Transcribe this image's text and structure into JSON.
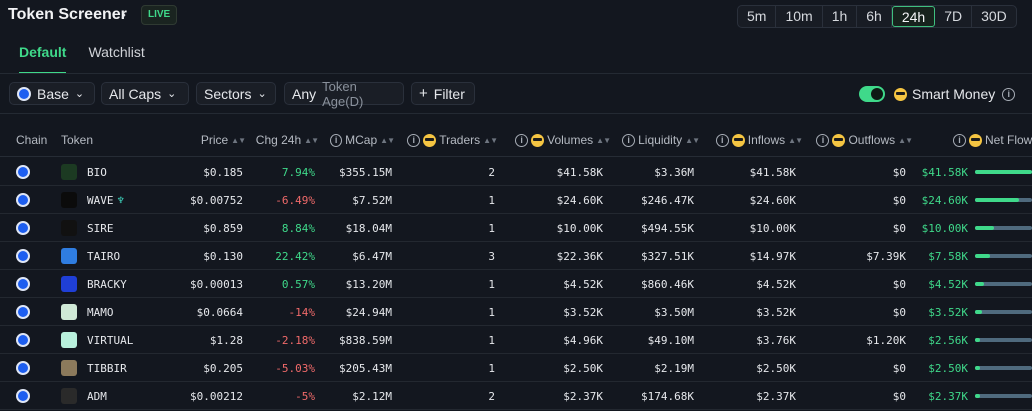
{
  "header": {
    "title": "Token Screener",
    "live_badge": "LIVE",
    "timeframes": [
      "5m",
      "10m",
      "1h",
      "6h",
      "24h",
      "7D",
      "30D"
    ],
    "active_timeframe": "24h"
  },
  "tabs": [
    {
      "label": "Default",
      "active": true
    },
    {
      "label": "Watchlist",
      "active": false
    }
  ],
  "filters": {
    "chain": "Base",
    "caps": "All Caps",
    "sectors": "Sectors",
    "token_age_value": "Any",
    "token_age_label": "Token Age(D)",
    "filter_button": "Filter",
    "smart_money_label": "Smart Money",
    "smart_money_enabled": true
  },
  "columns": {
    "chain": "Chain",
    "token": "Token",
    "price": "Price",
    "chg24h": "Chg 24h",
    "mcap": "MCap",
    "traders": "Traders",
    "volumes": "Volumes",
    "liquidity": "Liquidity",
    "inflows": "Inflows",
    "outflows": "Outflows",
    "netflow": "Net Flow"
  },
  "colors": {
    "accent": "#3fd98a",
    "negative": "#f06a6a",
    "background": "#13171f"
  },
  "rows": [
    {
      "token": "BIO",
      "price": "$0.185",
      "chg": "7.94%",
      "chg_dir": "pos",
      "mcap": "$355.15M",
      "traders": "2",
      "volumes": "$41.58K",
      "liquidity": "$3.36M",
      "inflows": "$41.58K",
      "outflows": "$0",
      "netflow": "$41.58K",
      "flow_share": 1.0,
      "icon_color": "#1c3a22",
      "verified": false
    },
    {
      "token": "WAVE",
      "price": "$0.00752",
      "chg": "-6.49%",
      "chg_dir": "neg",
      "mcap": "$7.52M",
      "traders": "1",
      "volumes": "$24.60K",
      "liquidity": "$246.47K",
      "inflows": "$24.60K",
      "outflows": "$0",
      "netflow": "$24.60K",
      "flow_share": 0.78,
      "icon_color": "#0b0b0b",
      "verified": true
    },
    {
      "token": "SIRE",
      "price": "$0.859",
      "chg": "8.84%",
      "chg_dir": "pos",
      "mcap": "$18.04M",
      "traders": "1",
      "volumes": "$10.00K",
      "liquidity": "$494.55K",
      "inflows": "$10.00K",
      "outflows": "$0",
      "netflow": "$10.00K",
      "flow_share": 0.34,
      "icon_color": "#111111",
      "verified": false
    },
    {
      "token": "TAIRO",
      "price": "$0.130",
      "chg": "22.42%",
      "chg_dir": "pos",
      "mcap": "$6.47M",
      "traders": "3",
      "volumes": "$22.36K",
      "liquidity": "$327.51K",
      "inflows": "$14.97K",
      "outflows": "$7.39K",
      "netflow": "$7.58K",
      "flow_share": 0.26,
      "icon_color": "#2f7de1",
      "verified": false
    },
    {
      "token": "BRACKY",
      "price": "$0.00013",
      "chg": "0.57%",
      "chg_dir": "pos",
      "mcap": "$13.20M",
      "traders": "1",
      "volumes": "$4.52K",
      "liquidity": "$860.46K",
      "inflows": "$4.52K",
      "outflows": "$0",
      "netflow": "$4.52K",
      "flow_share": 0.16,
      "icon_color": "#1f3fd6",
      "verified": false
    },
    {
      "token": "MAMO",
      "price": "$0.0664",
      "chg": "-14%",
      "chg_dir": "neg",
      "mcap": "$24.94M",
      "traders": "1",
      "volumes": "$3.52K",
      "liquidity": "$3.50M",
      "inflows": "$3.52K",
      "outflows": "$0",
      "netflow": "$3.52K",
      "flow_share": 0.13,
      "icon_color": "#cfe9d6",
      "verified": false
    },
    {
      "token": "VIRTUAL",
      "price": "$1.28",
      "chg": "-2.18%",
      "chg_dir": "neg",
      "mcap": "$838.59M",
      "traders": "1",
      "volumes": "$4.96K",
      "liquidity": "$49.10M",
      "inflows": "$3.76K",
      "outflows": "$1.20K",
      "netflow": "$2.56K",
      "flow_share": 0.09,
      "icon_color": "#b8f0dc",
      "verified": false
    },
    {
      "token": "TIBBIR",
      "price": "$0.205",
      "chg": "-5.03%",
      "chg_dir": "neg",
      "mcap": "$205.43M",
      "traders": "1",
      "volumes": "$2.50K",
      "liquidity": "$2.19M",
      "inflows": "$2.50K",
      "outflows": "$0",
      "netflow": "$2.50K",
      "flow_share": 0.09,
      "icon_color": "#8c7a5c",
      "verified": false
    },
    {
      "token": "ADM",
      "price": "$0.00212",
      "chg": "-5%",
      "chg_dir": "neg",
      "mcap": "$2.12M",
      "traders": "2",
      "volumes": "$2.37K",
      "liquidity": "$174.68K",
      "inflows": "$2.37K",
      "outflows": "$0",
      "netflow": "$2.37K",
      "flow_share": 0.09,
      "icon_color": "#2a2a2a",
      "verified": false
    }
  ]
}
